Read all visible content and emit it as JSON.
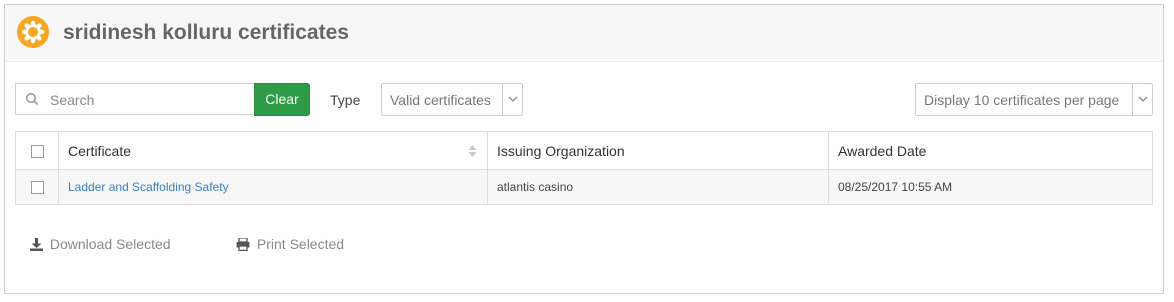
{
  "header": {
    "title": "sridinesh kolluru certificates",
    "badge_icon": "certificate-seal-icon",
    "badge_color": "#f5a623"
  },
  "toolbar": {
    "search_placeholder": "Search",
    "search_value": "",
    "clear_label": "Clear",
    "clear_color": "#2e9c47",
    "type_label": "Type",
    "type_selected": "Valid certificates",
    "per_page_selected": "Display 10 certificates per page"
  },
  "table": {
    "columns": [
      "Certificate",
      "Issuing Organization",
      "Awarded Date"
    ],
    "rows": [
      {
        "certificate": "Ladder and Scaffolding Safety",
        "organization": "atlantis casino",
        "awarded": "08/25/2017 10:55 AM"
      }
    ]
  },
  "actions": {
    "download_label": "Download Selected",
    "print_label": "Print Selected"
  },
  "colors": {
    "link": "#3a7fc1"
  }
}
